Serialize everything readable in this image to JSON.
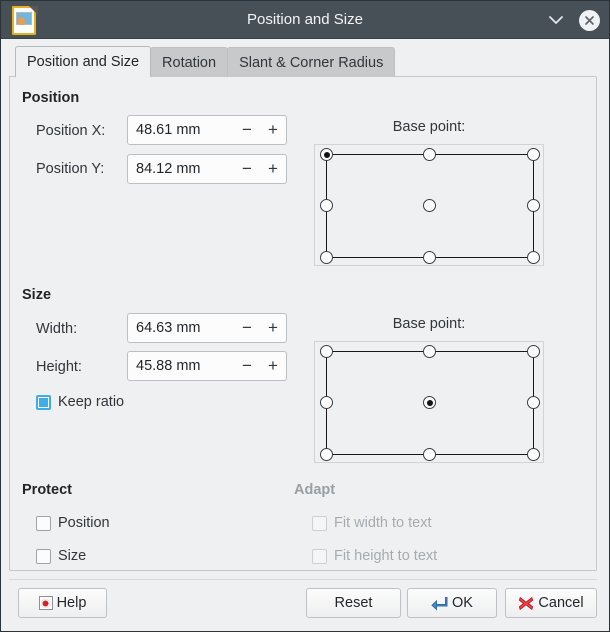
{
  "window": {
    "title": "Position and Size",
    "app_icon": "libreoffice-draw-document-icon",
    "shade_button": "chevron-down-icon",
    "close_button": "close-icon",
    "titlebar_color": "#475057",
    "background_color": "#eff0f1"
  },
  "tabs": [
    {
      "label": "Position and Size",
      "active": true
    },
    {
      "label": "Rotation",
      "active": false
    },
    {
      "label": "Slant & Corner Radius",
      "active": false
    }
  ],
  "position": {
    "group_label": "Position",
    "fields": [
      {
        "label": "Position X:",
        "value": "48.61 mm",
        "unit": "mm"
      },
      {
        "label": "Position Y:",
        "value": "84.12 mm",
        "unit": "mm"
      }
    ],
    "base_point": {
      "title": "Base point:",
      "selected": "top-left",
      "options": [
        "top-left",
        "top-center",
        "top-right",
        "middle-left",
        "center",
        "middle-right",
        "bottom-left",
        "bottom-center",
        "bottom-right"
      ]
    }
  },
  "size": {
    "group_label": "Size",
    "fields": [
      {
        "label": "Width:",
        "value": "64.63 mm",
        "unit": "mm"
      },
      {
        "label": "Height:",
        "value": "45.88 mm",
        "unit": "mm"
      }
    ],
    "keep_ratio": {
      "label": "Keep ratio",
      "checked": true,
      "accent": "#3daee9"
    },
    "base_point": {
      "title": "Base point:",
      "selected": "center",
      "options": [
        "top-left",
        "top-center",
        "top-right",
        "middle-left",
        "center",
        "middle-right",
        "bottom-left",
        "bottom-center",
        "bottom-right"
      ]
    }
  },
  "protect": {
    "group_label": "Protect",
    "items": [
      {
        "label": "Position",
        "checked": false,
        "enabled": true
      },
      {
        "label": "Size",
        "checked": false,
        "enabled": true
      }
    ]
  },
  "adapt": {
    "group_label": "Adapt",
    "enabled": false,
    "items": [
      {
        "label": "Fit width to text",
        "checked": false,
        "enabled": false
      },
      {
        "label": "Fit height to text",
        "checked": false,
        "enabled": false
      }
    ]
  },
  "spinner": {
    "decrement": "−",
    "increment": "+"
  },
  "buttons": {
    "help": {
      "label": "Help",
      "icon": "help-lifebuoy-icon"
    },
    "reset": {
      "label": "Reset"
    },
    "ok": {
      "label": "OK",
      "icon": "enter-arrow-icon",
      "icon_color": "#2f6fa8"
    },
    "cancel": {
      "label": "Cancel",
      "icon": "cross-x-icon",
      "icon_color": "#d4242a"
    }
  }
}
